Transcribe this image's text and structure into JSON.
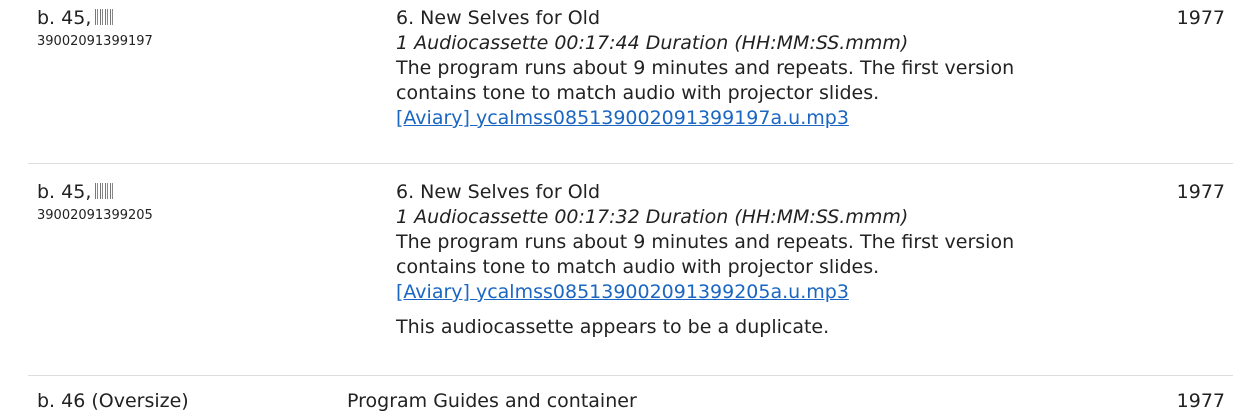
{
  "rows": [
    {
      "box": "b. 45,",
      "barcode": "39002091399197",
      "title": "6. New Selves for Old",
      "extent": "1 Audiocassette  00:17:44 Duration (HH:MM:SS.mmm)",
      "note_line1": "The program runs about 9 minutes and repeats. The first version",
      "note_line2": "contains tone to match audio with projector slides.",
      "link": "[Aviary] ycalmss085139002091399197a.u.mp3",
      "date": "1977"
    },
    {
      "box": "b. 45,",
      "barcode": "39002091399205",
      "title": "6. New Selves for Old",
      "extent": "1 Audiocassette  00:17:32 Duration (HH:MM:SS.mmm)",
      "note_line1": "The program runs about 9 minutes and repeats. The first version",
      "note_line2": "contains tone to match audio with projector slides.",
      "link": "[Aviary] ycalmss085139002091399205a.u.mp3",
      "extra_note": "This audiocassette appears to be a duplicate.",
      "date": "1977"
    },
    {
      "box": "b. 46 (Oversize)",
      "title": "Program Guides and container",
      "date": "1977"
    }
  ]
}
